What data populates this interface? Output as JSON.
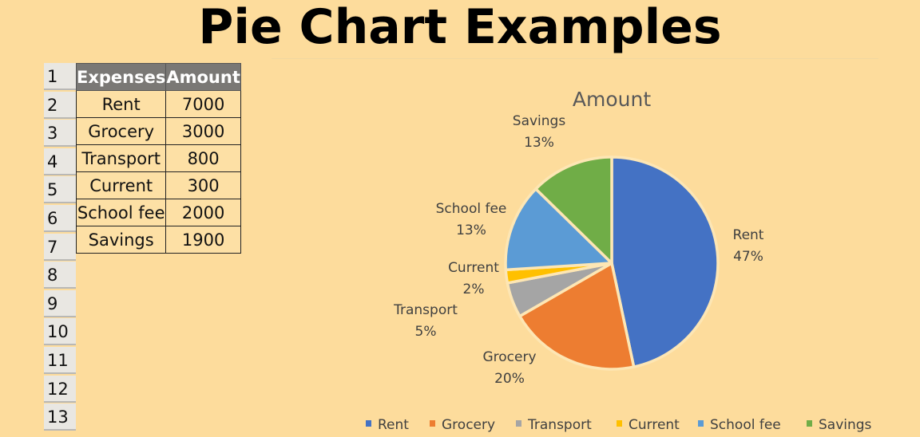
{
  "page": {
    "title": "Pie Chart Examples"
  },
  "sheet": {
    "row_numbers": [
      "1",
      "2",
      "3",
      "4",
      "5",
      "6",
      "7",
      "8",
      "9",
      "10",
      "11",
      "12",
      "13"
    ],
    "headers": [
      "Expenses",
      "Amount"
    ],
    "rows": [
      [
        "Rent",
        "7000"
      ],
      [
        "Grocery",
        "3000"
      ],
      [
        "Transport",
        "800"
      ],
      [
        "Current",
        "300"
      ],
      [
        "School fee",
        "2000"
      ],
      [
        "Savings",
        "1900"
      ]
    ]
  },
  "chart_data": {
    "type": "pie",
    "title": "Amount",
    "categories": [
      "Rent",
      "Grocery",
      "Transport",
      "Current",
      "School fee",
      "Savings"
    ],
    "values": [
      7000,
      3000,
      800,
      300,
      2000,
      1900
    ],
    "percent_labels": [
      "47%",
      "20%",
      "5%",
      "2%",
      "13%",
      "13%"
    ],
    "colors": [
      "#4472c4",
      "#ed7d31",
      "#a5a5a5",
      "#ffc000",
      "#5b9bd5",
      "#70ad47"
    ],
    "start_angle_deg": 0,
    "direction": "clockwise",
    "legend_position": "bottom",
    "data_labels": "outside, category name and percentage"
  }
}
